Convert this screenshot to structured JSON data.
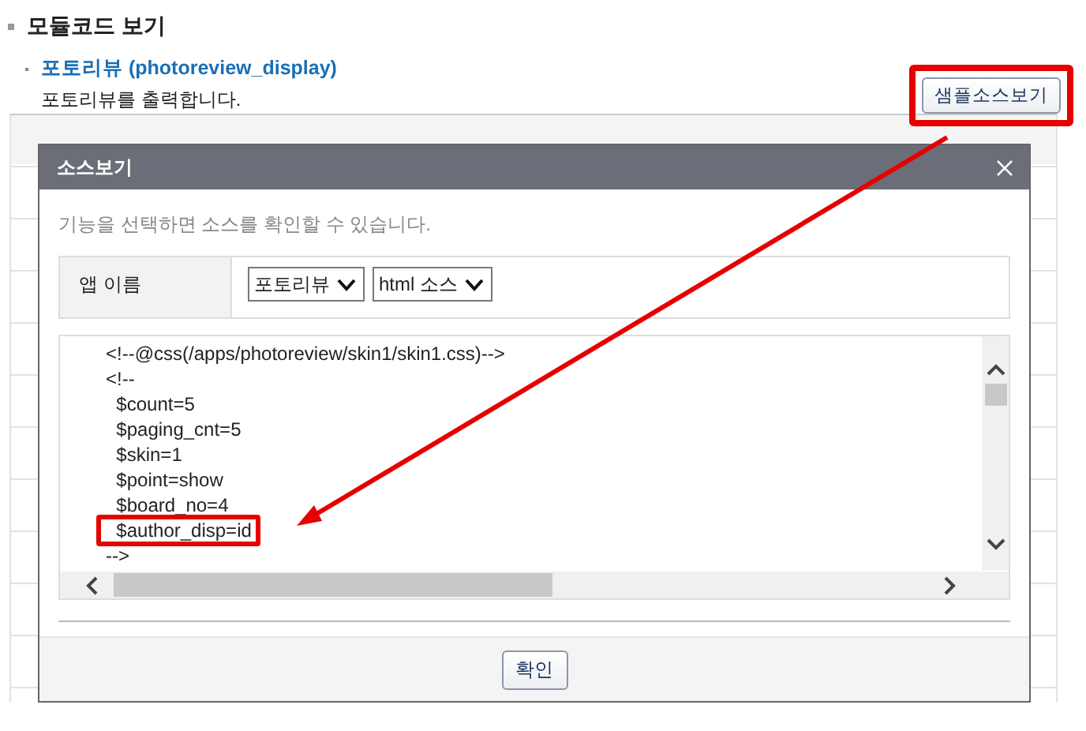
{
  "page": {
    "heading": "모듈코드 보기",
    "module": {
      "title": "포토리뷰 (photoreview_display)",
      "description": "포토리뷰를 출력합니다."
    },
    "sample_button": {
      "label": "샘플소스보기",
      "highlighted": true
    }
  },
  "dialog": {
    "title": "소스보기",
    "hint": "기능을 선택하면 소스를 확인할 수 있습니다.",
    "field_label": "앱 이름",
    "selects": [
      {
        "value": "포토리뷰"
      },
      {
        "value": "html 소스"
      }
    ],
    "code_lines": [
      {
        "text": "<!--@css(/apps/photoreview/skin1/skin1.css)-->",
        "highlighted": false
      },
      {
        "text": "<!--",
        "highlighted": false
      },
      {
        "text": "  $count=5",
        "highlighted": false
      },
      {
        "text": "  $paging_cnt=5",
        "highlighted": false
      },
      {
        "text": "  $skin=1",
        "highlighted": false
      },
      {
        "text": "  $point=show",
        "highlighted": false
      },
      {
        "text": "  $board_no=4",
        "highlighted": false
      },
      {
        "text": "  $author_disp=id",
        "highlighted": true
      },
      {
        "text": "-->",
        "highlighted": false
      }
    ],
    "confirm_button": "확인"
  }
}
